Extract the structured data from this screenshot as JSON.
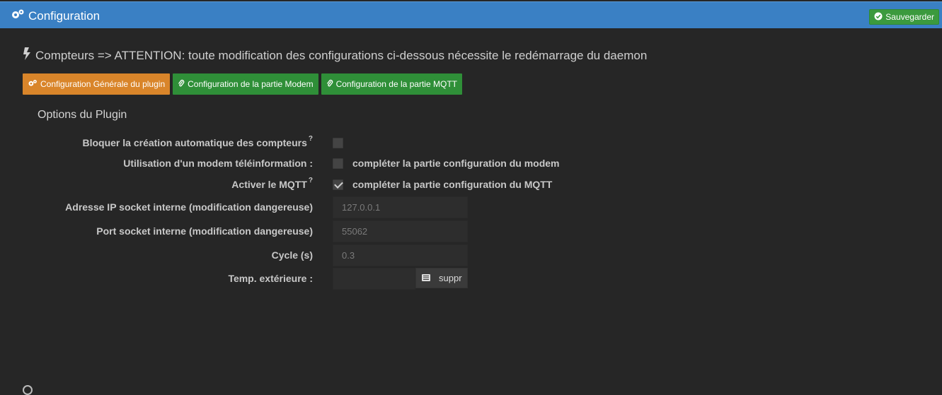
{
  "titlebar": {
    "title": "Configuration",
    "icon": "gears-icon"
  },
  "toolbar": {
    "save_label": "Sauvegarder"
  },
  "heading": {
    "text": "Compteurs => ATTENTION: toute modification des configurations ci-dessous nécessite le redémarrage du daemon",
    "icon": "bolt-icon"
  },
  "tabs": [
    {
      "label": "Configuration Générale du plugin",
      "color": "#d9852a",
      "icon": "gears-icon"
    },
    {
      "label": "Configuration de la partie Modem",
      "color": "#2f8f38",
      "icon": "paperclip-icon"
    },
    {
      "label": "Configuration de la partie MQTT",
      "color": "#2f8f38",
      "icon": "paperclip-icon"
    }
  ],
  "section": {
    "title": "Options du Plugin"
  },
  "options": {
    "block_auto": {
      "label": "Bloquer la création automatique des compteurs",
      "help": "?",
      "checked": false
    },
    "modem": {
      "label": "Utilisation d'un modem téléinformation :",
      "checked": false,
      "hint": "compléter la partie configuration du modem"
    },
    "mqtt": {
      "label": "Activer le MQTT",
      "help": "?",
      "checked": true,
      "hint": "compléter la partie configuration du MQTT"
    },
    "socket_ip": {
      "label": "Adresse IP socket interne (modification dangereuse)",
      "value": "127.0.0.1"
    },
    "socket_port": {
      "label": "Port socket interne (modification dangereuse)",
      "value": "55062"
    },
    "cycle": {
      "label": "Cycle (s)",
      "value": "0.3"
    },
    "temp_ext": {
      "label": "Temp. extérieure :",
      "value": "",
      "button_label": "suppr"
    }
  },
  "colors": {
    "titlebar": "#3a80c4",
    "background": "#262626",
    "save": "#3b9a3e"
  }
}
